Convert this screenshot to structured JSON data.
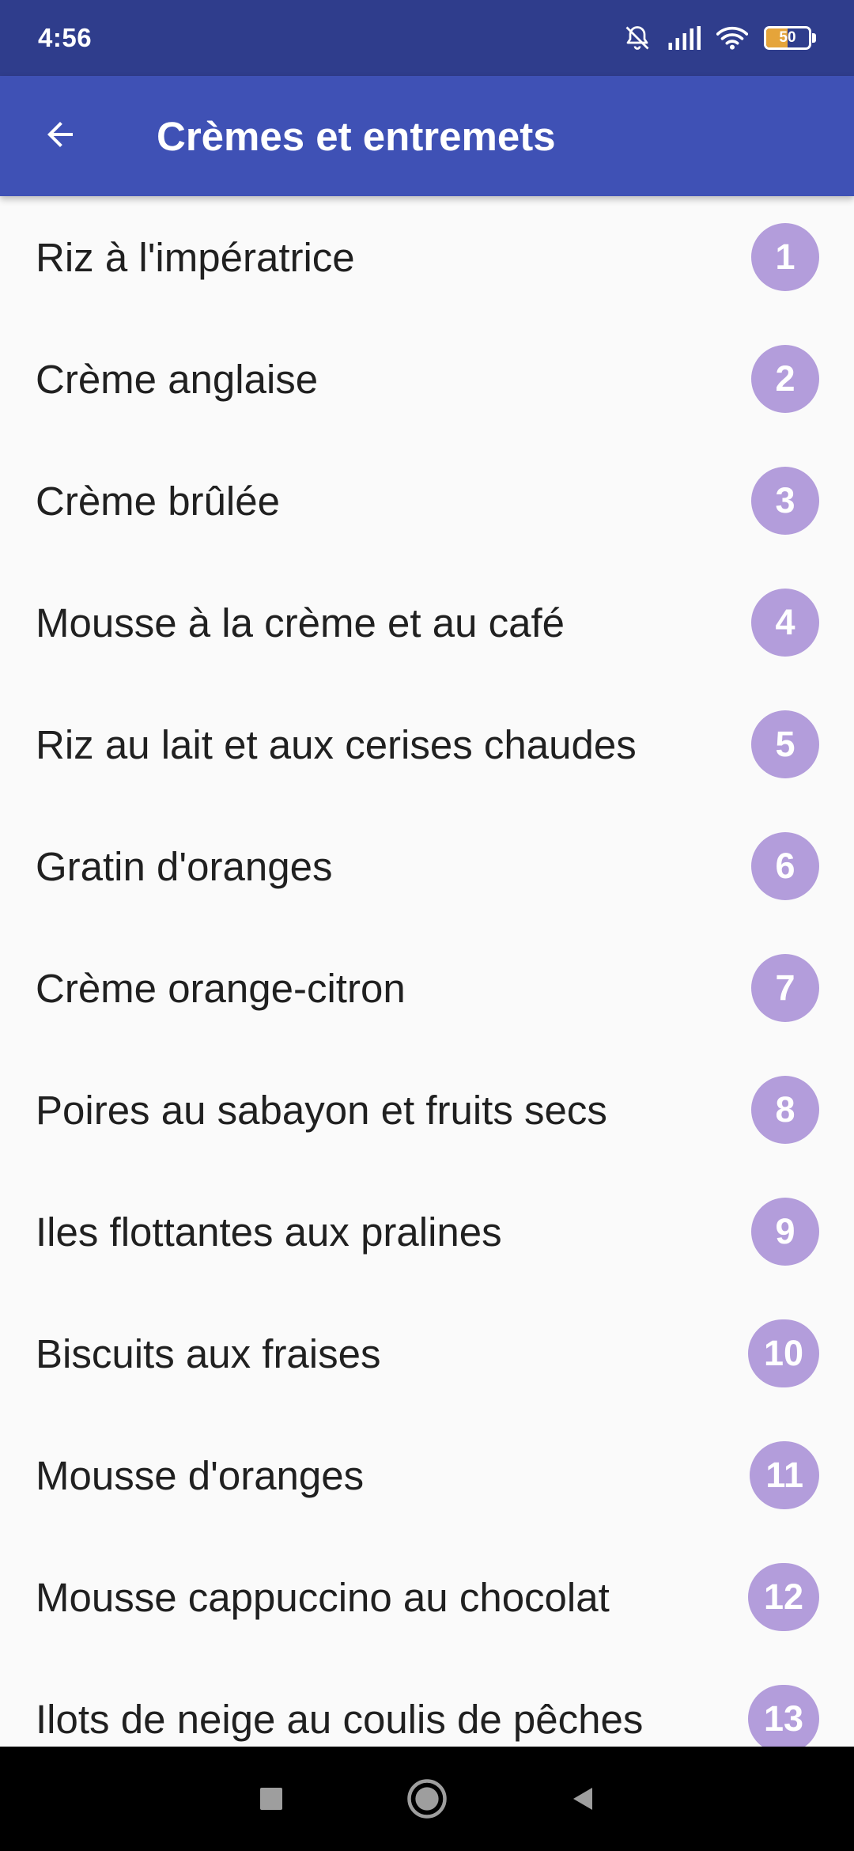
{
  "status_bar": {
    "time": "4:56",
    "battery_level": "50",
    "battery_fraction": 0.5,
    "icons": [
      "silent-icon",
      "signal-icon",
      "wifi-icon",
      "battery-icon"
    ]
  },
  "app_bar": {
    "back_icon": "arrow-back-icon",
    "title": "Crèmes et entremets"
  },
  "recipes": [
    {
      "label": "Riz à l'impératrice",
      "number": "1"
    },
    {
      "label": "Crème anglaise",
      "number": "2"
    },
    {
      "label": "Crème brûlée",
      "number": "3"
    },
    {
      "label": "Mousse à la crème et au café",
      "number": "4"
    },
    {
      "label": "Riz au lait et aux cerises chaudes",
      "number": "5"
    },
    {
      "label": "Gratin d'oranges",
      "number": "6"
    },
    {
      "label": "Crème orange-citron",
      "number": "7"
    },
    {
      "label": "Poires au sabayon et fruits secs",
      "number": "8"
    },
    {
      "label": "Iles flottantes aux pralines",
      "number": "9"
    },
    {
      "label": "Biscuits aux fraises",
      "number": "10"
    },
    {
      "label": "Mousse d'oranges",
      "number": "11"
    },
    {
      "label": "Mousse cappuccino au chocolat",
      "number": "12"
    },
    {
      "label": "Ilots de neige au coulis de pêches",
      "number": "13"
    }
  ],
  "nav_bar": {
    "buttons": [
      "recents-icon",
      "home-icon",
      "back-icon"
    ]
  },
  "colors": {
    "status_bar": "#2f3d8c",
    "app_bar": "#3f51b5",
    "badge": "#b39ddb",
    "background": "#fafafa",
    "battery_fill": "#e5a43a"
  }
}
